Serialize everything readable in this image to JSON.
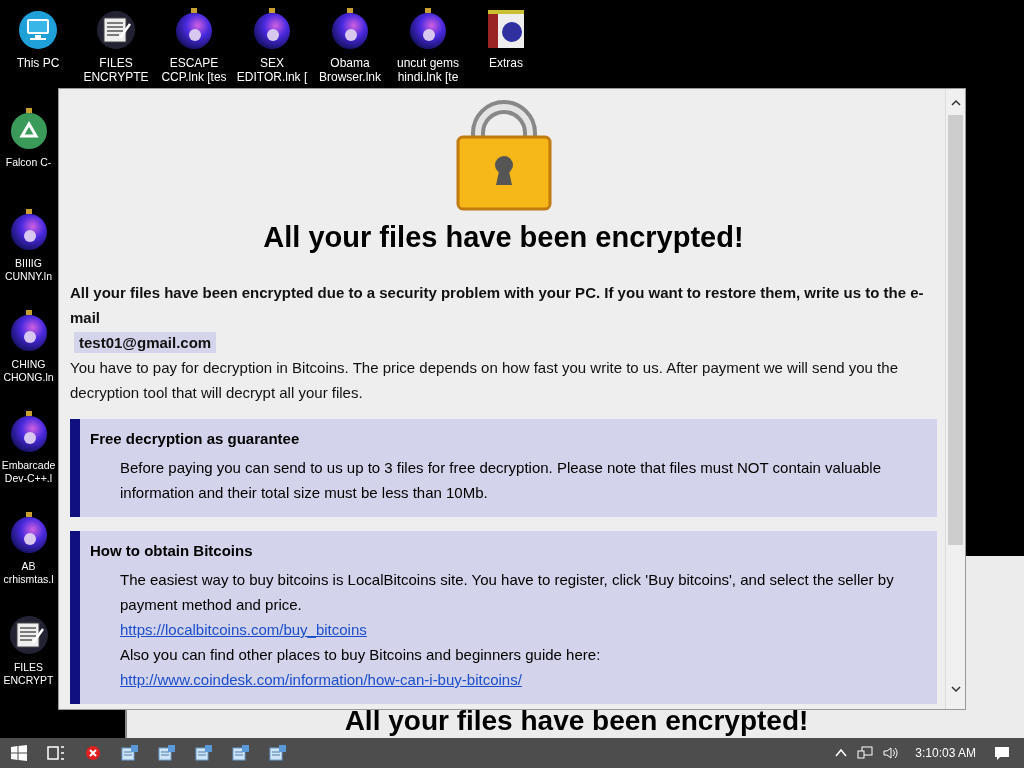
{
  "top_row_icons": [
    {
      "kind": "computer",
      "lines": [
        "This PC"
      ]
    },
    {
      "kind": "document",
      "lines": [
        "FILES",
        "ENCRYPTE"
      ]
    },
    {
      "kind": "ornament",
      "lines": [
        "ESCAPE",
        "CCP.lnk [tes"
      ]
    },
    {
      "kind": "ornament",
      "lines": [
        "SEX",
        "EDITOR.lnk ["
      ]
    },
    {
      "kind": "ornament",
      "lines": [
        "Obama",
        "Browser.lnk"
      ]
    },
    {
      "kind": "ornament",
      "lines": [
        "uncut gems",
        "hindi.lnk [te"
      ]
    },
    {
      "kind": "box",
      "lines": [
        "Extras"
      ]
    }
  ],
  "left_column_icons": [
    {
      "kind": "recycle",
      "lines": [
        "Falcon C-"
      ]
    },
    {
      "kind": "ornament",
      "lines": [
        "BIIIIG",
        "CUNNY.ln"
      ]
    },
    {
      "kind": "ornament",
      "lines": [
        "CHING",
        "CHONG.ln"
      ]
    },
    {
      "kind": "ornament",
      "lines": [
        "Embarcade",
        "Dev-C++.l"
      ]
    },
    {
      "kind": "ornament",
      "lines": [
        "AB",
        "crhismtas.l"
      ]
    },
    {
      "kind": "document",
      "lines": [
        "FILES",
        "ENCRYPT"
      ]
    }
  ],
  "back_window": {
    "heading": "All your files have been encrypted!"
  },
  "note_window": {
    "heading": "All your files have been encrypted!",
    "intro": "All your files have been encrypted due to a security problem with your PC. If you want to restore them, write us to the e-mail",
    "email": "test01@gmail.com",
    "payment": "You have to pay for decryption in Bitcoins. The price depends on how fast you write to us. After payment we will send you the decryption tool that will decrypt all your files.",
    "sections": [
      {
        "title": "Free decryption as guarantee",
        "items": [
          {
            "kind": "text",
            "text": "Before paying you can send to us up to 3 files for free decryption. Please note that files must NOT contain valuable information and their total size must be less than 10Mb."
          }
        ]
      },
      {
        "title": "How to obtain Bitcoins",
        "items": [
          {
            "kind": "text",
            "text": "The easiest way to buy bitcoins is LocalBitcoins site. You have to register, click 'Buy bitcoins', and select the seller by payment method and price."
          },
          {
            "kind": "link",
            "text": "https://localbitcoins.com/buy_bitcoins"
          },
          {
            "kind": "text",
            "text": "Also you can find other places to buy Bitcoins and beginners guide here:"
          },
          {
            "kind": "link",
            "text": "http://www.coindesk.com/information/how-can-i-buy-bitcoins/"
          }
        ]
      }
    ]
  },
  "taskbar": {
    "apps": [
      {
        "kind": "start"
      },
      {
        "kind": "task-view"
      },
      {
        "kind": "red"
      },
      {
        "kind": "app"
      },
      {
        "kind": "app"
      },
      {
        "kind": "app"
      },
      {
        "kind": "app"
      },
      {
        "kind": "app"
      }
    ],
    "clock": "3:10:03 AM"
  }
}
